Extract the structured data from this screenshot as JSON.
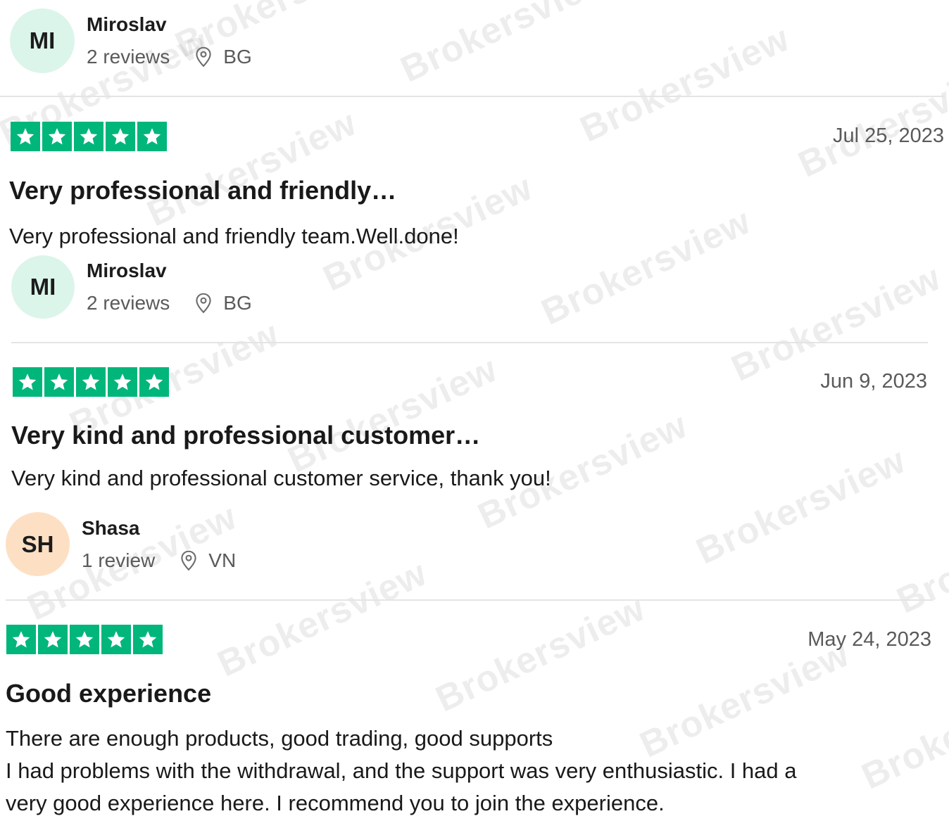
{
  "watermark": "Brokersview",
  "header_profile": {
    "initials": "MI",
    "name": "Miroslav",
    "reviews": "2 reviews",
    "location": "BG"
  },
  "reviews": [
    {
      "rating": 5,
      "date": "Jul 25, 2023",
      "title": "Very professional and friendly…",
      "body": [
        "Very professional and friendly team.Well.done!"
      ],
      "author": {
        "initials": "MI",
        "name": "Miroslav",
        "reviews": "2 reviews",
        "location": "BG"
      }
    },
    {
      "rating": 5,
      "date": "Jun 9, 2023",
      "title": "Very kind and professional customer…",
      "body": [
        "Very kind and professional customer service, thank you!"
      ],
      "author": {
        "initials": "SH",
        "name": "Shasa",
        "reviews": "1 review",
        "location": "VN"
      }
    },
    {
      "rating": 5,
      "date": "May 24, 2023",
      "title": "Good experience",
      "body": [
        "There are enough products, good trading, good supports",
        "I had problems with the withdrawal, and the support was very enthusiastic. I had a",
        "very good experience here. I recommend you to join the experience."
      ]
    }
  ],
  "colors": {
    "star_green": "#00b67a",
    "avatar_green": "#dcf5ea",
    "avatar_peach": "#fde0c4"
  },
  "icons": {
    "star": "star-icon",
    "location": "location-pin-icon"
  }
}
